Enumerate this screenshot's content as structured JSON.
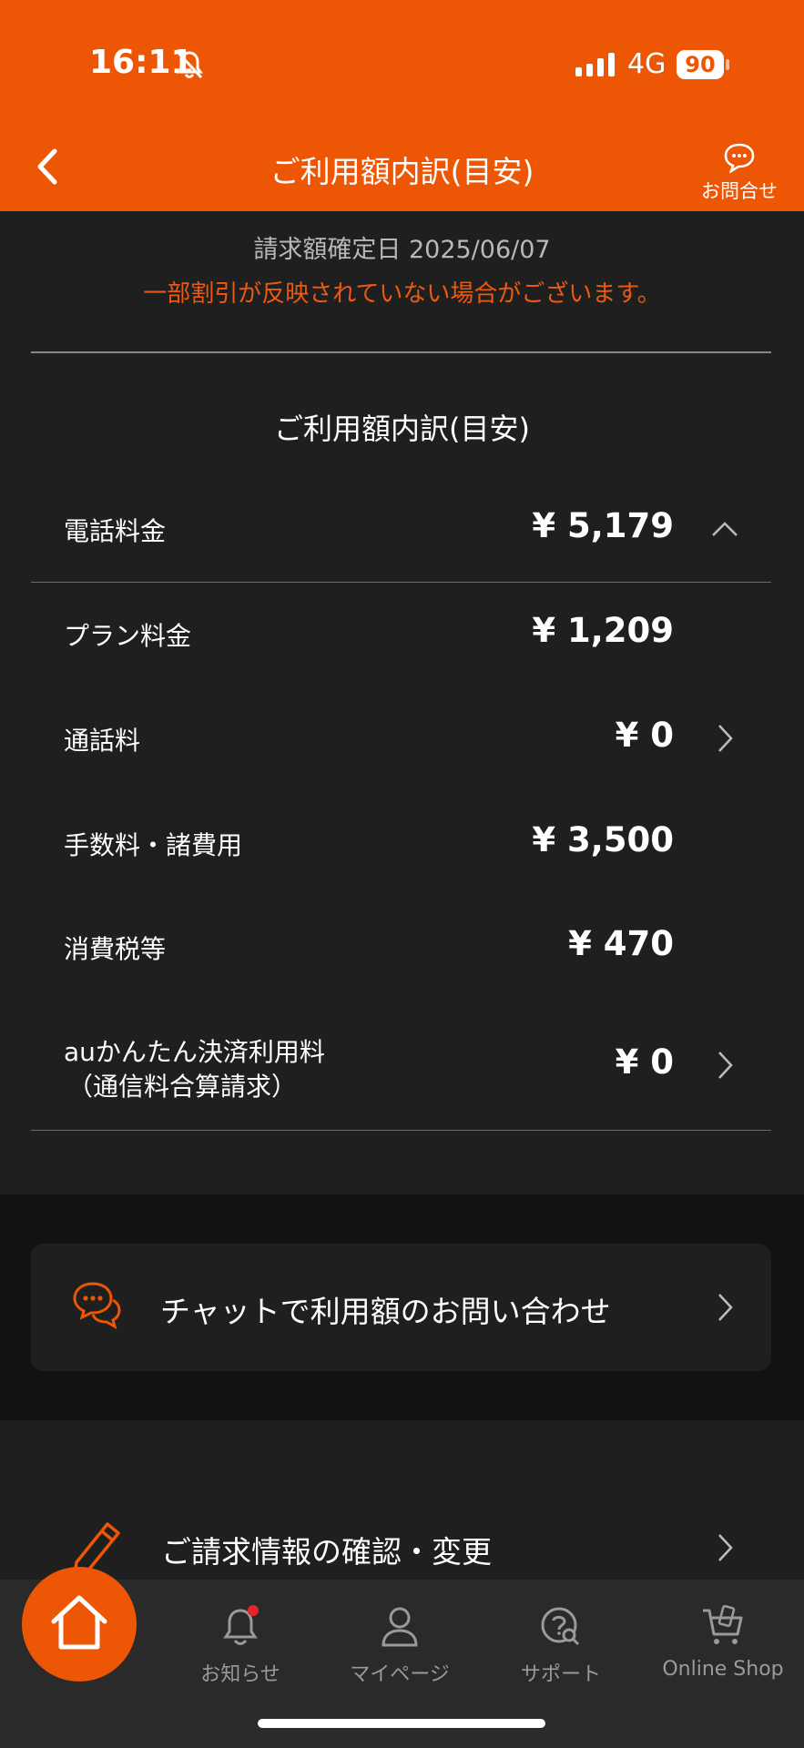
{
  "status_bar": {
    "time": "16:11",
    "network": "4G",
    "battery": "90"
  },
  "header": {
    "title": "ご利用額内訳(目安)",
    "contact_label": "お問合せ"
  },
  "billing_info": {
    "confirm_date": "請求額確定日 2025/06/07",
    "notice": "一部割引が反映されていない場合がございます。"
  },
  "breakdown": {
    "section_title": "ご利用額内訳(目安)",
    "total": {
      "label": "電話料金",
      "amount": "¥ 5,179"
    },
    "items": [
      {
        "label": "プラン料金",
        "amount": "¥ 1,209"
      },
      {
        "label": "通話料",
        "amount": "¥ 0"
      },
      {
        "label": "手数料・諸費用",
        "amount": "¥ 3,500"
      },
      {
        "label": "消費税等",
        "amount": "¥ 470"
      },
      {
        "label_line1": "auかんたん決済利用料",
        "label_line2": "（通信料合算請求）",
        "amount": "¥ 0"
      }
    ]
  },
  "chat": {
    "label": "チャットで利用額のお問い合わせ"
  },
  "billing_link": {
    "label": "ご請求情報の確認・変更"
  },
  "tab_bar": {
    "tabs": [
      {
        "label": "お知らせ",
        "icon": "bell-icon"
      },
      {
        "label": "マイページ",
        "icon": "person-icon"
      },
      {
        "label": "サポート",
        "icon": "support-icon"
      },
      {
        "label": "Online Shop",
        "icon": "cart-icon"
      }
    ]
  },
  "colors": {
    "accent": "#ec5605",
    "background": "#1f1f1f",
    "notification_dot": "#e8242b"
  }
}
